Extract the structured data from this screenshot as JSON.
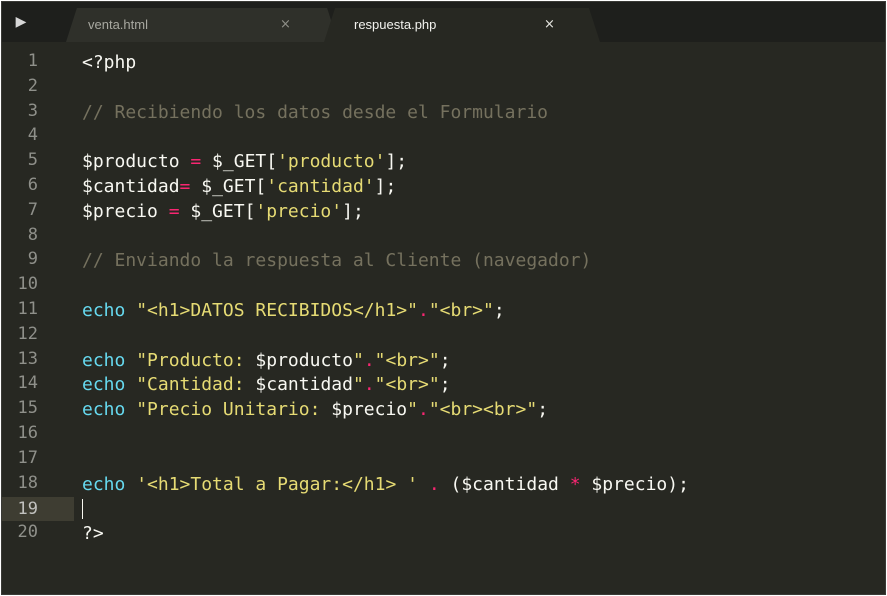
{
  "tabs": [
    {
      "label": "venta.html",
      "close": "×",
      "active": false
    },
    {
      "label": "respuesta.php",
      "close": "×",
      "active": true
    }
  ],
  "sidebar_toggle": "▶",
  "lines": [
    {
      "num": "1",
      "tokens": [
        {
          "t": "<?php",
          "c": "pl"
        }
      ]
    },
    {
      "num": "2",
      "tokens": []
    },
    {
      "num": "3",
      "tokens": [
        {
          "t": "// Recibiendo los datos desde el Formulario",
          "c": "cm"
        }
      ]
    },
    {
      "num": "4",
      "tokens": []
    },
    {
      "num": "5",
      "tokens": [
        {
          "t": "$producto ",
          "c": "pl"
        },
        {
          "t": "=",
          "c": "op"
        },
        {
          "t": " $_GET[",
          "c": "pl"
        },
        {
          "t": "'producto'",
          "c": "str"
        },
        {
          "t": "];",
          "c": "pl"
        }
      ]
    },
    {
      "num": "6",
      "tokens": [
        {
          "t": "$cantidad",
          "c": "pl"
        },
        {
          "t": "=",
          "c": "op"
        },
        {
          "t": " $_GET[",
          "c": "pl"
        },
        {
          "t": "'cantidad'",
          "c": "str"
        },
        {
          "t": "];",
          "c": "pl"
        }
      ]
    },
    {
      "num": "7",
      "tokens": [
        {
          "t": "$precio ",
          "c": "pl"
        },
        {
          "t": "=",
          "c": "op"
        },
        {
          "t": " $_GET[",
          "c": "pl"
        },
        {
          "t": "'precio'",
          "c": "str"
        },
        {
          "t": "];",
          "c": "pl"
        }
      ]
    },
    {
      "num": "8",
      "tokens": []
    },
    {
      "num": "9",
      "tokens": [
        {
          "t": "// Enviando la respuesta al Cliente (navegador)",
          "c": "cm"
        }
      ]
    },
    {
      "num": "10",
      "tokens": []
    },
    {
      "num": "11",
      "tokens": [
        {
          "t": "echo",
          "c": "kw"
        },
        {
          "t": " ",
          "c": "pl"
        },
        {
          "t": "\"<h1>DATOS RECIBIDOS</h1>\"",
          "c": "str"
        },
        {
          "t": ".",
          "c": "op"
        },
        {
          "t": "\"<br>\"",
          "c": "str"
        },
        {
          "t": ";",
          "c": "pl"
        }
      ]
    },
    {
      "num": "12",
      "tokens": []
    },
    {
      "num": "13",
      "tokens": [
        {
          "t": "echo",
          "c": "kw"
        },
        {
          "t": " ",
          "c": "pl"
        },
        {
          "t": "\"Producto: ",
          "c": "str"
        },
        {
          "t": "$producto",
          "c": "pl"
        },
        {
          "t": "\"",
          "c": "str"
        },
        {
          "t": ".",
          "c": "op"
        },
        {
          "t": "\"<br>\"",
          "c": "str"
        },
        {
          "t": ";",
          "c": "pl"
        }
      ]
    },
    {
      "num": "14",
      "tokens": [
        {
          "t": "echo",
          "c": "kw"
        },
        {
          "t": " ",
          "c": "pl"
        },
        {
          "t": "\"Cantidad: ",
          "c": "str"
        },
        {
          "t": "$cantidad",
          "c": "pl"
        },
        {
          "t": "\"",
          "c": "str"
        },
        {
          "t": ".",
          "c": "op"
        },
        {
          "t": "\"<br>\"",
          "c": "str"
        },
        {
          "t": ";",
          "c": "pl"
        }
      ]
    },
    {
      "num": "15",
      "tokens": [
        {
          "t": "echo",
          "c": "kw"
        },
        {
          "t": " ",
          "c": "pl"
        },
        {
          "t": "\"Precio Unitario: ",
          "c": "str"
        },
        {
          "t": "$precio",
          "c": "pl"
        },
        {
          "t": "\"",
          "c": "str"
        },
        {
          "t": ".",
          "c": "op"
        },
        {
          "t": "\"<br><br>\"",
          "c": "str"
        },
        {
          "t": ";",
          "c": "pl"
        }
      ]
    },
    {
      "num": "16",
      "tokens": []
    },
    {
      "num": "17",
      "tokens": []
    },
    {
      "num": "18",
      "tokens": [
        {
          "t": "echo",
          "c": "kw"
        },
        {
          "t": " ",
          "c": "pl"
        },
        {
          "t": "'<h1>Total a Pagar:</h1> '",
          "c": "str"
        },
        {
          "t": " ",
          "c": "pl"
        },
        {
          "t": ".",
          "c": "op"
        },
        {
          "t": " ($cantidad ",
          "c": "pl"
        },
        {
          "t": "*",
          "c": "op"
        },
        {
          "t": " $precio);",
          "c": "pl"
        }
      ]
    },
    {
      "num": "19",
      "tokens": [],
      "current": true
    },
    {
      "num": "20",
      "tokens": [
        {
          "t": "?>",
          "c": "pl"
        }
      ]
    }
  ],
  "colors": {
    "background": "#272822",
    "keyword": "#66d9ef",
    "string": "#e6db74",
    "comment": "#75715e",
    "operator": "#f92672",
    "plain": "#f8f8f2"
  }
}
